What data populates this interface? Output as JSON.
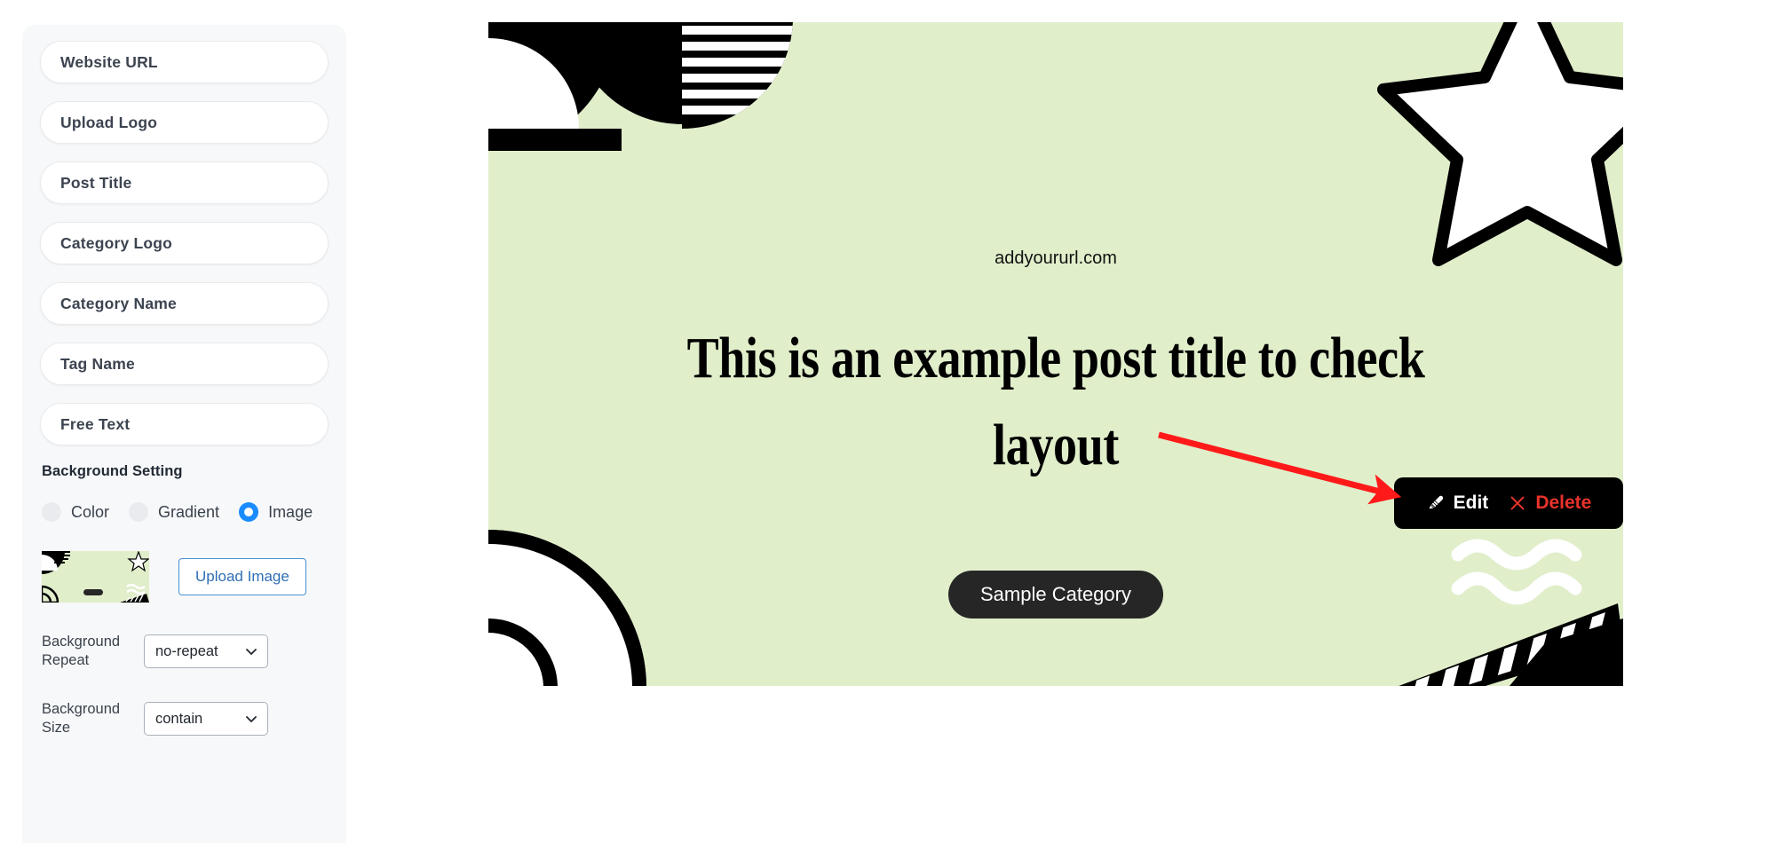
{
  "sidebar": {
    "fields": [
      {
        "label": "Website URL",
        "name": "website-url"
      },
      {
        "label": "Upload Logo",
        "name": "upload-logo"
      },
      {
        "label": "Post Title",
        "name": "post-title"
      },
      {
        "label": "Category Logo",
        "name": "category-logo"
      },
      {
        "label": "Category Name",
        "name": "category-name"
      },
      {
        "label": "Tag Name",
        "name": "tag-name"
      },
      {
        "label": "Free Text",
        "name": "free-text"
      }
    ],
    "background_setting": {
      "title": "Background Setting",
      "options": [
        {
          "label": "Color",
          "selected": false
        },
        {
          "label": "Gradient",
          "selected": false
        },
        {
          "label": "Image",
          "selected": true
        }
      ],
      "upload_button": "Upload Image",
      "repeat": {
        "label": "Background Repeat",
        "value": "no-repeat"
      },
      "size": {
        "label": "Background Size",
        "value": "contain"
      }
    }
  },
  "canvas": {
    "url": "addyoururl.com",
    "title": "This is an example post title to check layout",
    "category": "Sample Category",
    "background_color": "#e0eeca"
  },
  "toolbar": {
    "edit_label": "Edit",
    "delete_label": "Delete",
    "edit_icon": "pencil-icon",
    "delete_icon": "close-x-icon",
    "delete_color": "#e8322b"
  },
  "annotation": {
    "arrow_color": "#ff1a1a"
  }
}
